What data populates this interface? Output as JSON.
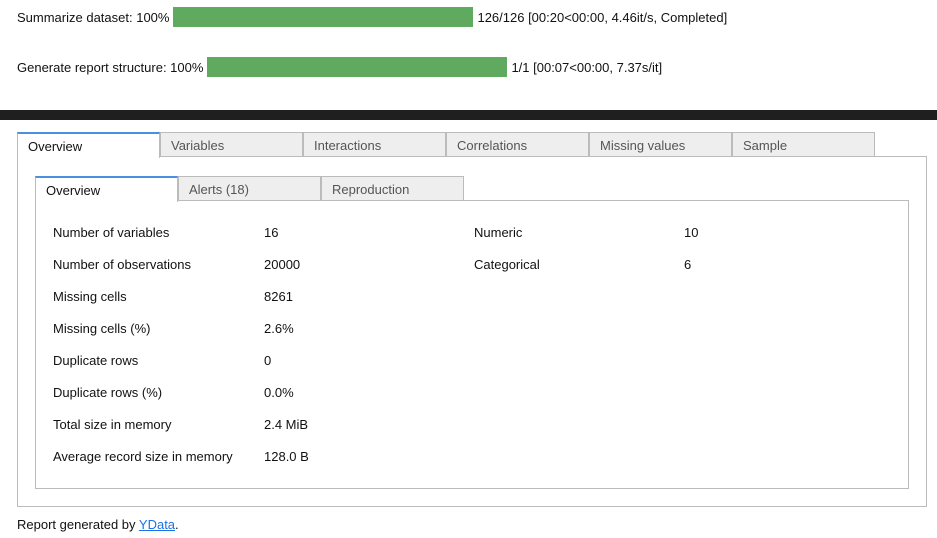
{
  "progress": [
    {
      "label": "Summarize dataset: 100%",
      "fraction": 1.0,
      "status": "126/126 [00:20<00:00, 4.46it/s, Completed]"
    },
    {
      "label": "Generate report structure: 100%",
      "fraction": 1.0,
      "status": "1/1 [00:07<00:00, 7.37s/it]"
    }
  ],
  "outer_tabs": [
    "Overview",
    "Variables",
    "Interactions",
    "Correlations",
    "Missing values",
    "Sample"
  ],
  "inner_tabs": [
    "Overview",
    "Alerts (18)",
    "Reproduction"
  ],
  "dataset_statistics": [
    {
      "label": "Number of variables",
      "value": "16"
    },
    {
      "label": "Number of observations",
      "value": "20000"
    },
    {
      "label": "Missing cells",
      "value": "8261"
    },
    {
      "label": "Missing cells (%)",
      "value": "2.6%"
    },
    {
      "label": "Duplicate rows",
      "value": "0"
    },
    {
      "label": "Duplicate rows (%)",
      "value": "0.0%"
    },
    {
      "label": "Total size in memory",
      "value": "2.4 MiB"
    },
    {
      "label": "Average record size in memory",
      "value": "128.0 B"
    }
  ],
  "variable_types": [
    {
      "label": "Numeric",
      "value": "10"
    },
    {
      "label": "Categorical",
      "value": "6"
    }
  ],
  "footer": {
    "prefix": "Report generated by ",
    "link": "YData",
    "suffix": "."
  },
  "colors": {
    "progress_fill": "#5faa5f",
    "active_tab_border": "#4a90e2",
    "link": "#1a73e8",
    "band": "#1f1f1f"
  }
}
